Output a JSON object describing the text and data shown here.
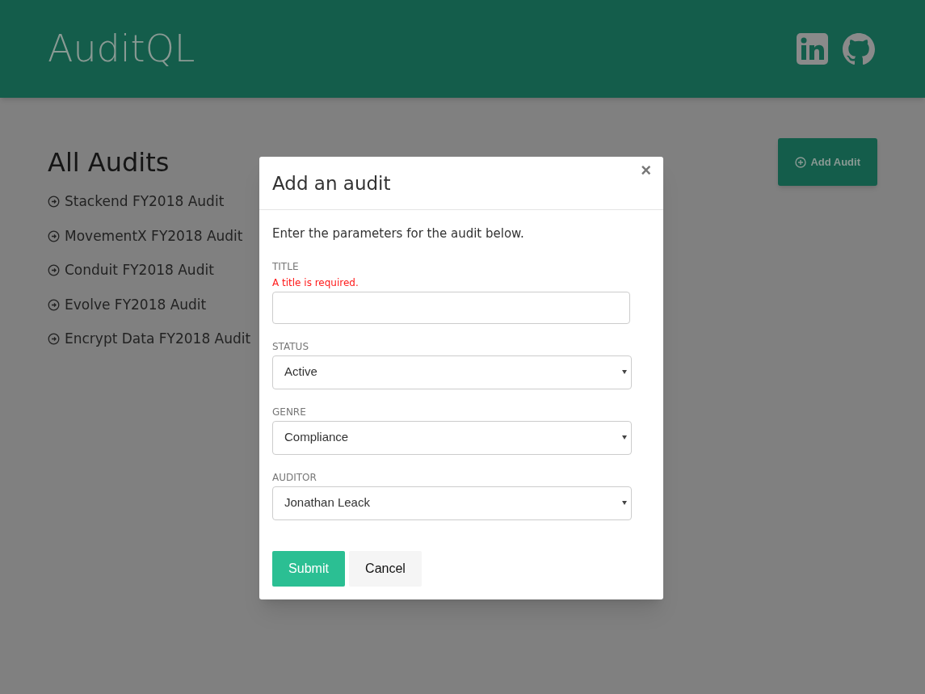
{
  "header": {
    "title": "AuditQL"
  },
  "audits": {
    "heading": "All Audits",
    "items": [
      "Stackend FY2018 Audit",
      "MovementX FY2018 Audit",
      "Conduit FY2018 Audit",
      "Evolve FY2018 Audit",
      "Encrypt Data FY2018 Audit"
    ]
  },
  "add_button": {
    "label": "Add Audit"
  },
  "modal": {
    "title": "Add an audit",
    "close": "×",
    "intro": "Enter the parameters for the audit below.",
    "fields": [
      {
        "kind": "text",
        "label": "TITLE",
        "error": "A title is required."
      },
      {
        "kind": "select",
        "label": "STATUS",
        "value": "Active"
      },
      {
        "kind": "select",
        "label": "GENRE",
        "value": "Compliance"
      },
      {
        "kind": "select",
        "label": "AUDITOR",
        "value": "Jonathan Leack"
      }
    ],
    "submit": "Submit",
    "cancel": "Cancel"
  }
}
